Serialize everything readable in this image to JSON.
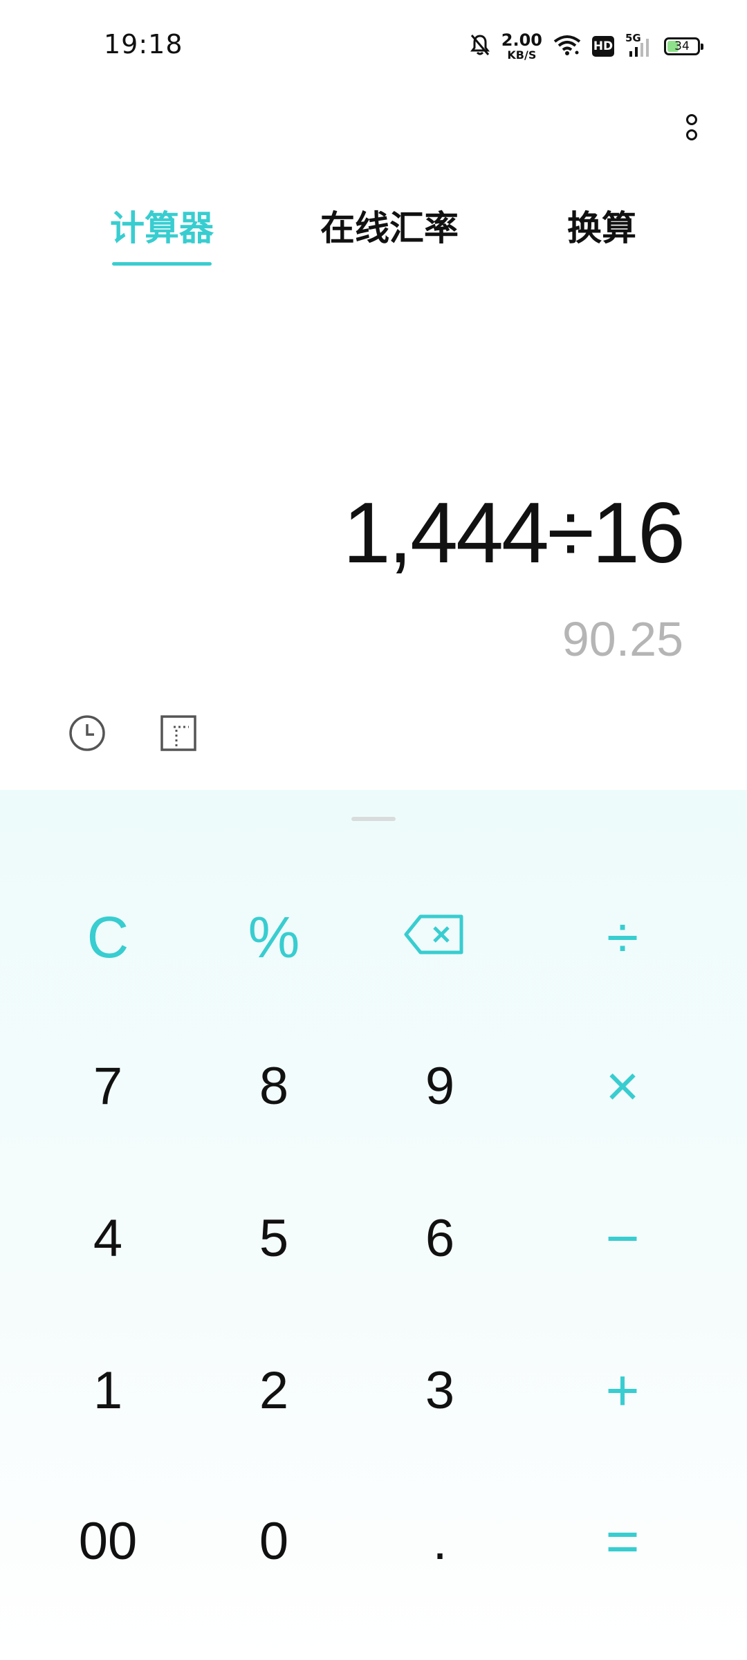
{
  "status_bar": {
    "time": "19:18",
    "net_speed_value": "2.00",
    "net_speed_unit": "KB/S",
    "hd_label": "HD",
    "network_label": "5G",
    "battery_level": "34",
    "icons": [
      "bell-muted-icon",
      "wifi-icon",
      "hd-icon",
      "signal-icon",
      "battery-icon"
    ]
  },
  "tabs": [
    {
      "label": "计算器",
      "active": true
    },
    {
      "label": "在线汇率",
      "active": false
    },
    {
      "label": "换算",
      "active": false
    }
  ],
  "display": {
    "expression": "1,444÷16",
    "result": "90.25"
  },
  "tools": {
    "history_icon": "clock-icon",
    "scientific_icon": "scientific-mode-icon"
  },
  "keypad": {
    "rows": [
      [
        {
          "label": "C",
          "type": "op"
        },
        {
          "label": "%",
          "type": "op"
        },
        {
          "label": "",
          "type": "op",
          "icon": "backspace-icon"
        },
        {
          "label": "÷",
          "type": "op"
        }
      ],
      [
        {
          "label": "7",
          "type": "num"
        },
        {
          "label": "8",
          "type": "num"
        },
        {
          "label": "9",
          "type": "num"
        },
        {
          "label": "×",
          "type": "op"
        }
      ],
      [
        {
          "label": "4",
          "type": "num"
        },
        {
          "label": "5",
          "type": "num"
        },
        {
          "label": "6",
          "type": "num"
        },
        {
          "label": "−",
          "type": "op"
        }
      ],
      [
        {
          "label": "1",
          "type": "num"
        },
        {
          "label": "2",
          "type": "num"
        },
        {
          "label": "3",
          "type": "num"
        },
        {
          "label": "+",
          "type": "op"
        }
      ],
      [
        {
          "label": "00",
          "type": "num"
        },
        {
          "label": "0",
          "type": "num"
        },
        {
          "label": ".",
          "type": "num"
        },
        {
          "label": "=",
          "type": "op"
        }
      ]
    ]
  },
  "colors": {
    "accent": "#38cdd0",
    "text": "#111111",
    "result_text": "#b5b5b5",
    "keypad_bg": "#eefbfb"
  }
}
